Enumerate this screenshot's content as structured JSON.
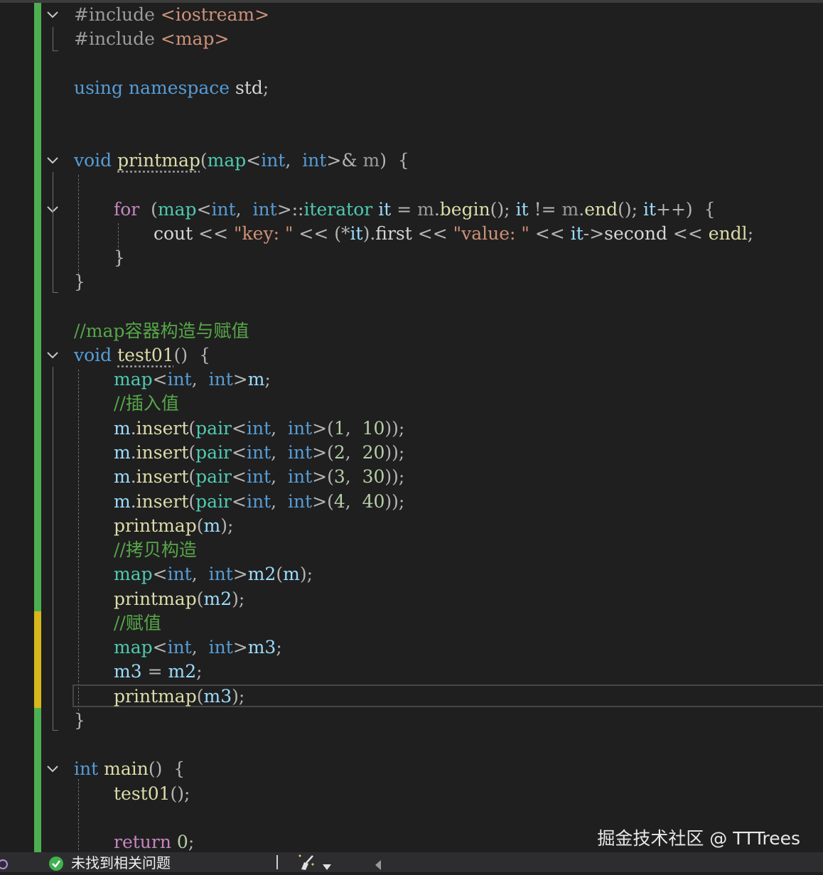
{
  "colors": {
    "background": "#1f1f1f",
    "keyword": "#569cd6",
    "type": "#4ec9b0",
    "function": "#dcdcaa",
    "variable": "#9cdcfe",
    "string": "#ce9178",
    "number": "#b5cea8",
    "comment": "#57a64a",
    "change_bar_saved": "#4caf50",
    "change_bar_unsaved": "#d7b71a"
  },
  "code": {
    "include_iostream": "#include",
    "include_iostream_header": "<iostream>",
    "include_map": "#include",
    "include_map_header": "<map>",
    "using": "using",
    "namespace": "namespace",
    "std": "std",
    "void1": "void",
    "printmap_name": "printmap",
    "map_kw": "map",
    "int": "int",
    "param_m": "m",
    "for": "for",
    "iterator": "iterator",
    "it": "it",
    "begin": "begin",
    "end": "end",
    "cout": "cout",
    "str_key": "\"key: \"",
    "first": "first",
    "str_value": "\"value: \"",
    "second": "second",
    "endl": "endl",
    "comment_map": "//map容器构造与赋值",
    "void2": "void",
    "test01_name": "test01",
    "insert": "insert",
    "pair": "pair",
    "comment_insert": "//插入值",
    "comment_copy": "//拷贝构造",
    "comment_assign": "//赋值",
    "m2": "m2",
    "m3": "m3",
    "main_int": "int",
    "main_name": "main",
    "return": "return",
    "zero": "0",
    "pairs": [
      [
        "1",
        "10"
      ],
      [
        "2",
        "20"
      ],
      [
        "3",
        "30"
      ],
      [
        "4",
        "40"
      ]
    ]
  },
  "watermark": "掘金技术社区 @ TTTrees",
  "statusbar": {
    "issues_text": "未找到相关问题"
  }
}
